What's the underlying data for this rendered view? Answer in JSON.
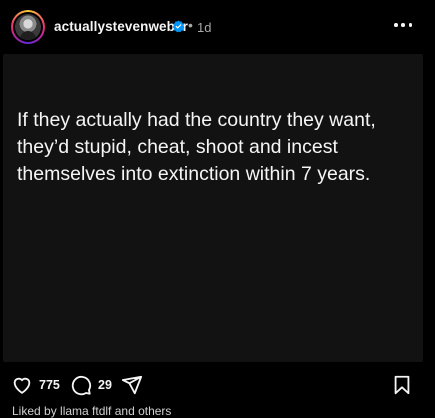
{
  "post": {
    "username": "actuallystevenweber",
    "time_sep": "•",
    "time_ago": "1d",
    "text": "If they actually had the country they want, they’d stupid, cheat, shoot and incest themselves into extinction within 7 years."
  },
  "actions": {
    "likes": "775",
    "comments": "29"
  },
  "caption": {
    "text": "Liked by  llama  ftdlf  and  others"
  },
  "icons": {
    "verified": "verified-badge-icon",
    "more": "more-options-icon",
    "like": "heart-icon",
    "comment": "comment-icon",
    "share": "send-icon",
    "save": "bookmark-icon"
  },
  "colors": {
    "background": "#000000",
    "card": "#121212",
    "text": "#f5f5f5",
    "muted": "#a8a8a8",
    "verified": "#0095f6"
  }
}
